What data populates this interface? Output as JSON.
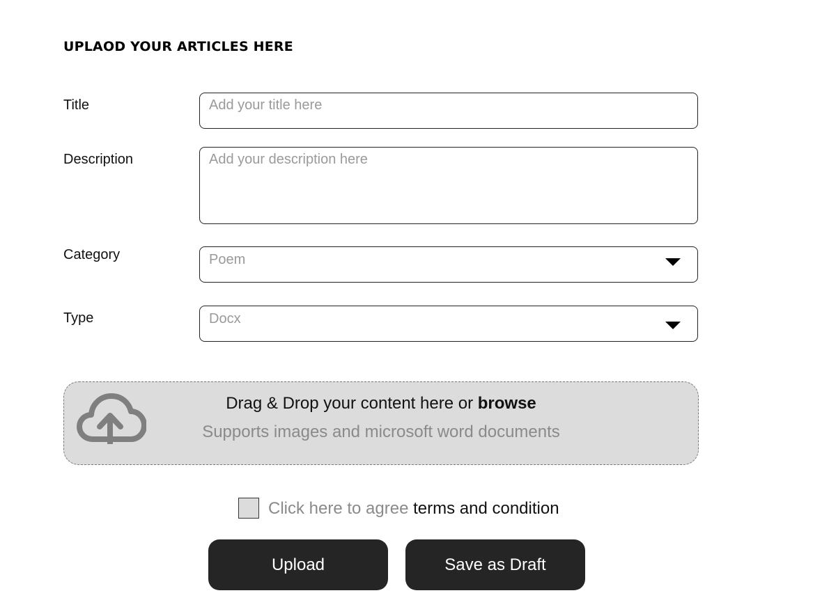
{
  "form": {
    "heading": "UPLAOD YOUR ARTICLES HERE",
    "title": {
      "label": "Title",
      "placeholder": "Add your title here",
      "value": ""
    },
    "description": {
      "label": "Description",
      "placeholder": "Add your description here",
      "value": ""
    },
    "category": {
      "label": "Category",
      "selected": "Poem"
    },
    "type": {
      "label": "Type",
      "selected": "Docx"
    }
  },
  "dropzone": {
    "icon": "cloud-upload-icon",
    "text_prefix": "Drag & Drop your content here or ",
    "browse_label": "browse",
    "supports_text": "Supports images and microsoft word documents",
    "color": "#dcdcdc"
  },
  "agreement": {
    "checked": false,
    "prefix": "Click here to agree ",
    "link_text": "terms and condition"
  },
  "actions": {
    "upload_label": "Upload",
    "draft_label": "Save as Draft",
    "button_color": "#252525"
  }
}
